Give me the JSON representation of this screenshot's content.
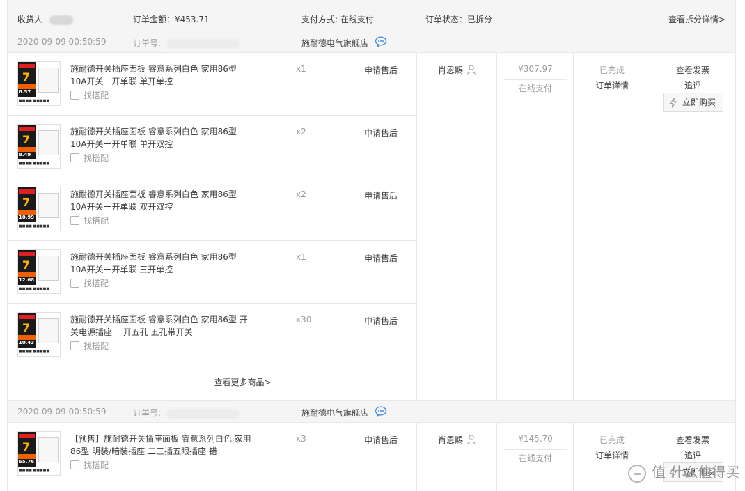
{
  "summary": {
    "receiver_label": "收货人",
    "total_label": "订单金额：¥453.71",
    "payment_label": "支付方式: 在线支付",
    "status_label": "订单状态：已拆分",
    "split_link": "查看拆分详情>"
  },
  "orders": [
    {
      "date": "2020-09-09 00:50:59",
      "order_no_label": "订单号:",
      "shop": "施耐德电气旗舰店",
      "items": [
        {
          "name": "施耐德开关插座面板 睿意系列白色 家用86型 10A开关一开单联 单开单控",
          "qty": "x1",
          "aftersale": "申请售后",
          "match": "找搭配",
          "price_tag": "6.57"
        },
        {
          "name": "施耐德开关插座面板 睿意系列白色 家用86型 10A开关一开单联 单开双控",
          "qty": "x2",
          "aftersale": "申请售后",
          "match": "找搭配",
          "price_tag": "8.49"
        },
        {
          "name": "施耐德开关插座面板 睿意系列白色 家用86型 10A开关一开单联 双开双控",
          "qty": "x2",
          "aftersale": "申请售后",
          "match": "找搭配",
          "price_tag": "10.99"
        },
        {
          "name": "施耐德开关插座面板 睿意系列白色 家用86型 10A开关一开单联 三开单控",
          "qty": "x1",
          "aftersale": "申请售后",
          "match": "找搭配",
          "price_tag": "12.68"
        },
        {
          "name": "施耐德开关插座面板 睿意系列白色 家用86型 开关电源插座 一开五孔 五孔带开关",
          "qty": "x30",
          "aftersale": "申请售后",
          "match": "找搭配",
          "price_tag": "10.43"
        }
      ],
      "more_link": "查看更多商品>",
      "buyer": "肖恩赐",
      "amount": "¥307.97",
      "pay_type": "在线支付",
      "status": "已完成",
      "detail_link": "订单详情",
      "invoice_link": "查看发票",
      "review_link": "追评",
      "buy_again": "立即购买"
    },
    {
      "date": "2020-09-09 00:50:59",
      "order_no_label": "订单号:",
      "shop": "施耐德电气旗舰店",
      "items": [
        {
          "name": "【预售】施耐德开关插座面板 睿意系列白色 家用86型 明装/暗装插座 二三插五眼插座 错",
          "qty": "x3",
          "aftersale": "申请售后",
          "match": "找搭配",
          "price_tag": "65.76"
        }
      ],
      "buyer": "肖恩赐",
      "amount": "¥145.70",
      "pay_type": "在线支付",
      "status": "已完成",
      "detail_link": "订单详情",
      "invoice_link": "查看发票",
      "review_link": "追评",
      "buy_again": "立即购买"
    }
  ],
  "watermark": "值 什么值得买"
}
